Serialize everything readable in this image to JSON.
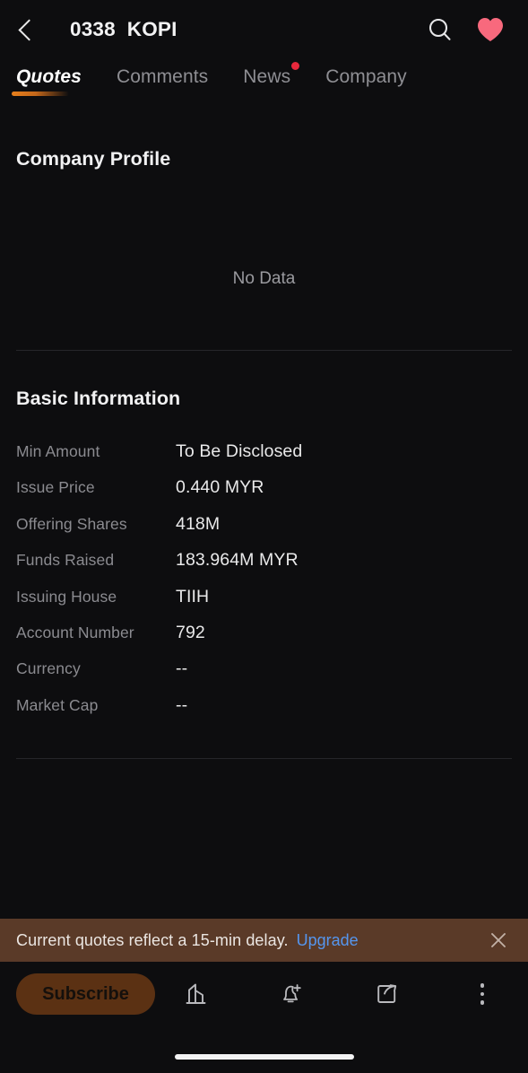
{
  "header": {
    "back_icon": "chevron-left-icon",
    "title": "0338  KOPI",
    "search_icon": "search-icon",
    "favorite_icon": "heart-icon",
    "favorite_color": "#f8697d"
  },
  "tabs": [
    {
      "label": "Quotes",
      "active": true,
      "badge": false
    },
    {
      "label": "Comments",
      "active": false,
      "badge": false
    },
    {
      "label": "News",
      "active": false,
      "badge": true
    },
    {
      "label": "Company",
      "active": false,
      "badge": false
    }
  ],
  "profile": {
    "title": "Company Profile",
    "empty_text": "No Data"
  },
  "basic_information": {
    "title": "Basic Information",
    "rows": [
      {
        "label": "Min Amount",
        "value": "To Be Disclosed"
      },
      {
        "label": "Issue Price",
        "value": "0.440 MYR"
      },
      {
        "label": "Offering Shares",
        "value": "418M"
      },
      {
        "label": "Funds Raised",
        "value": "183.964M MYR"
      },
      {
        "label": "Issuing House",
        "value": "TIIH"
      },
      {
        "label": "Account Number",
        "value": "792"
      },
      {
        "label": "Currency",
        "value": "--"
      },
      {
        "label": "Market Cap",
        "value": "--"
      }
    ]
  },
  "banner": {
    "text": "Current quotes reflect a 15-min delay.",
    "link_label": "Upgrade",
    "close_icon": "close-icon",
    "background": "#5a3a28",
    "link_color": "#5596ef"
  },
  "bottom_bar": {
    "subscribe_label": "Subscribe",
    "subscribe_color": "#5b3113",
    "icons": [
      {
        "name": "exchange-building-icon"
      },
      {
        "name": "bell-add-icon"
      },
      {
        "name": "share-icon"
      },
      {
        "name": "more-vertical-icon"
      }
    ]
  }
}
